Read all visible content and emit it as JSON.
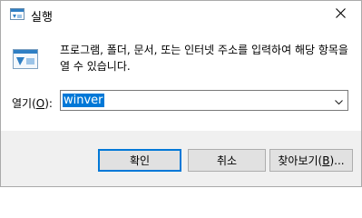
{
  "window": {
    "title": "실행",
    "app_icon": "run-icon",
    "close_icon": "close-icon"
  },
  "body": {
    "icon": "run-dialog-icon",
    "description": "프로그램, 폴더, 문서, 또는 인터넷 주소를 입력하여 해당 항목을 열 수 있습니다."
  },
  "open_field": {
    "label_prefix": "열기(",
    "label_accel": "O",
    "label_suffix": "):",
    "value": "winver",
    "dropdown_icon": "chevron-down-icon"
  },
  "buttons": {
    "ok_label": "확인",
    "cancel_label": "취소",
    "browse_prefix": "찾아보기(",
    "browse_accel": "B",
    "browse_suffix": ")..."
  },
  "colors": {
    "accent": "#0078d7",
    "footer_bg": "#f0f0f0",
    "button_bg": "#e1e1e1"
  }
}
